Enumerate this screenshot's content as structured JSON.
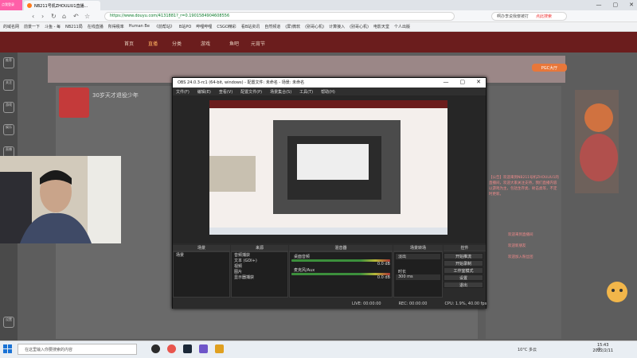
{
  "browser": {
    "tab_title": "NB211号机ZHOULIU1直播...",
    "window_controls": [
      "—",
      "▢",
      "✕"
    ],
    "url": "https://www.douyu.com/4131881?_r=0.1901584904608556",
    "search_placeholder": "啊办李说我傻被打",
    "search_suffix": "点此搜索",
    "profile_label": "点我登录",
    "bookmarks": [
      "的域名网",
      "前景一下",
      "斗鱼 - 每",
      "NB211局",
      "在线直播",
      "所得税率",
      "Human Be",
      "《前帮站》",
      "B站PO",
      "哔哩哔哩",
      "CSGO精彩",
      "看B站资讯",
      "自然频道",
      "(屏)微软",
      "(别哥心机)",
      "计算接入",
      "(别哥心机)",
      "电影天堂",
      "个人出版"
    ]
  },
  "site": {
    "nav_items": [
      "首页",
      "直播",
      "分类",
      "游戏",
      "鱼吧",
      "元宵节"
    ],
    "room_title": "30岁天才退役少年",
    "side_icons": [
      "推荐",
      "关注",
      "游戏",
      "娱乐",
      "直播",
      "设置"
    ],
    "right_text": "【公告】欢迎来到NB211号机ZHOULIU1的直播间，欢迎大家关注支持，我们直播内容以游戏为主，包括生存类、射击类等，不定时更新。",
    "right_links": [
      "欢迎来到直播间",
      "欢迎新朋友",
      "欢迎加入粉丝团"
    ],
    "pgc_label": "PGC大厅"
  },
  "obs": {
    "title": "OBS 24.0.3-rc1 (64-bit, windows) - 配置文件: 未命名 - 场景: 未命名",
    "menu": [
      "文件(F)",
      "编辑(E)",
      "查看(V)",
      "配置文件(P)",
      "场景集合(S)",
      "工具(T)",
      "帮助(H)"
    ],
    "docks": {
      "scenes": "场景",
      "sources": "来源",
      "mixer": "混音器",
      "transitions": "场景转场",
      "controls": "控件"
    },
    "scene_list": [
      "场景"
    ],
    "source_list": [
      "音频捕获",
      "文本 (GDI+)",
      "视频",
      "图片",
      "显示器捕获"
    ],
    "mixer_tracks": [
      {
        "name": "桌面音频",
        "db": "0.0 dB"
      },
      {
        "name": "麦克风/Aux",
        "db": "0.0 dB"
      }
    ],
    "transition": {
      "type": "淡出",
      "duration_label": "时长",
      "duration": "300 ms"
    },
    "control_buttons": [
      "开始推流",
      "开始录制",
      "工作室模式",
      "设置",
      "退出"
    ],
    "status": [
      "LIVE: 00:00:00",
      "REC: 00:00:00",
      "CPU: 1.9%, 40.00 fps"
    ]
  },
  "taskbar": {
    "search_placeholder": "在这里输入你要搜索的内容",
    "weather": "10°C 多云",
    "ime": "中",
    "time": "15:43",
    "date": "2022/2/11"
  },
  "colors": {
    "douyu_nav": "#6b1d1d",
    "obs_bg": "#2b2b2b",
    "accent_orange": "#ff7a1a"
  }
}
